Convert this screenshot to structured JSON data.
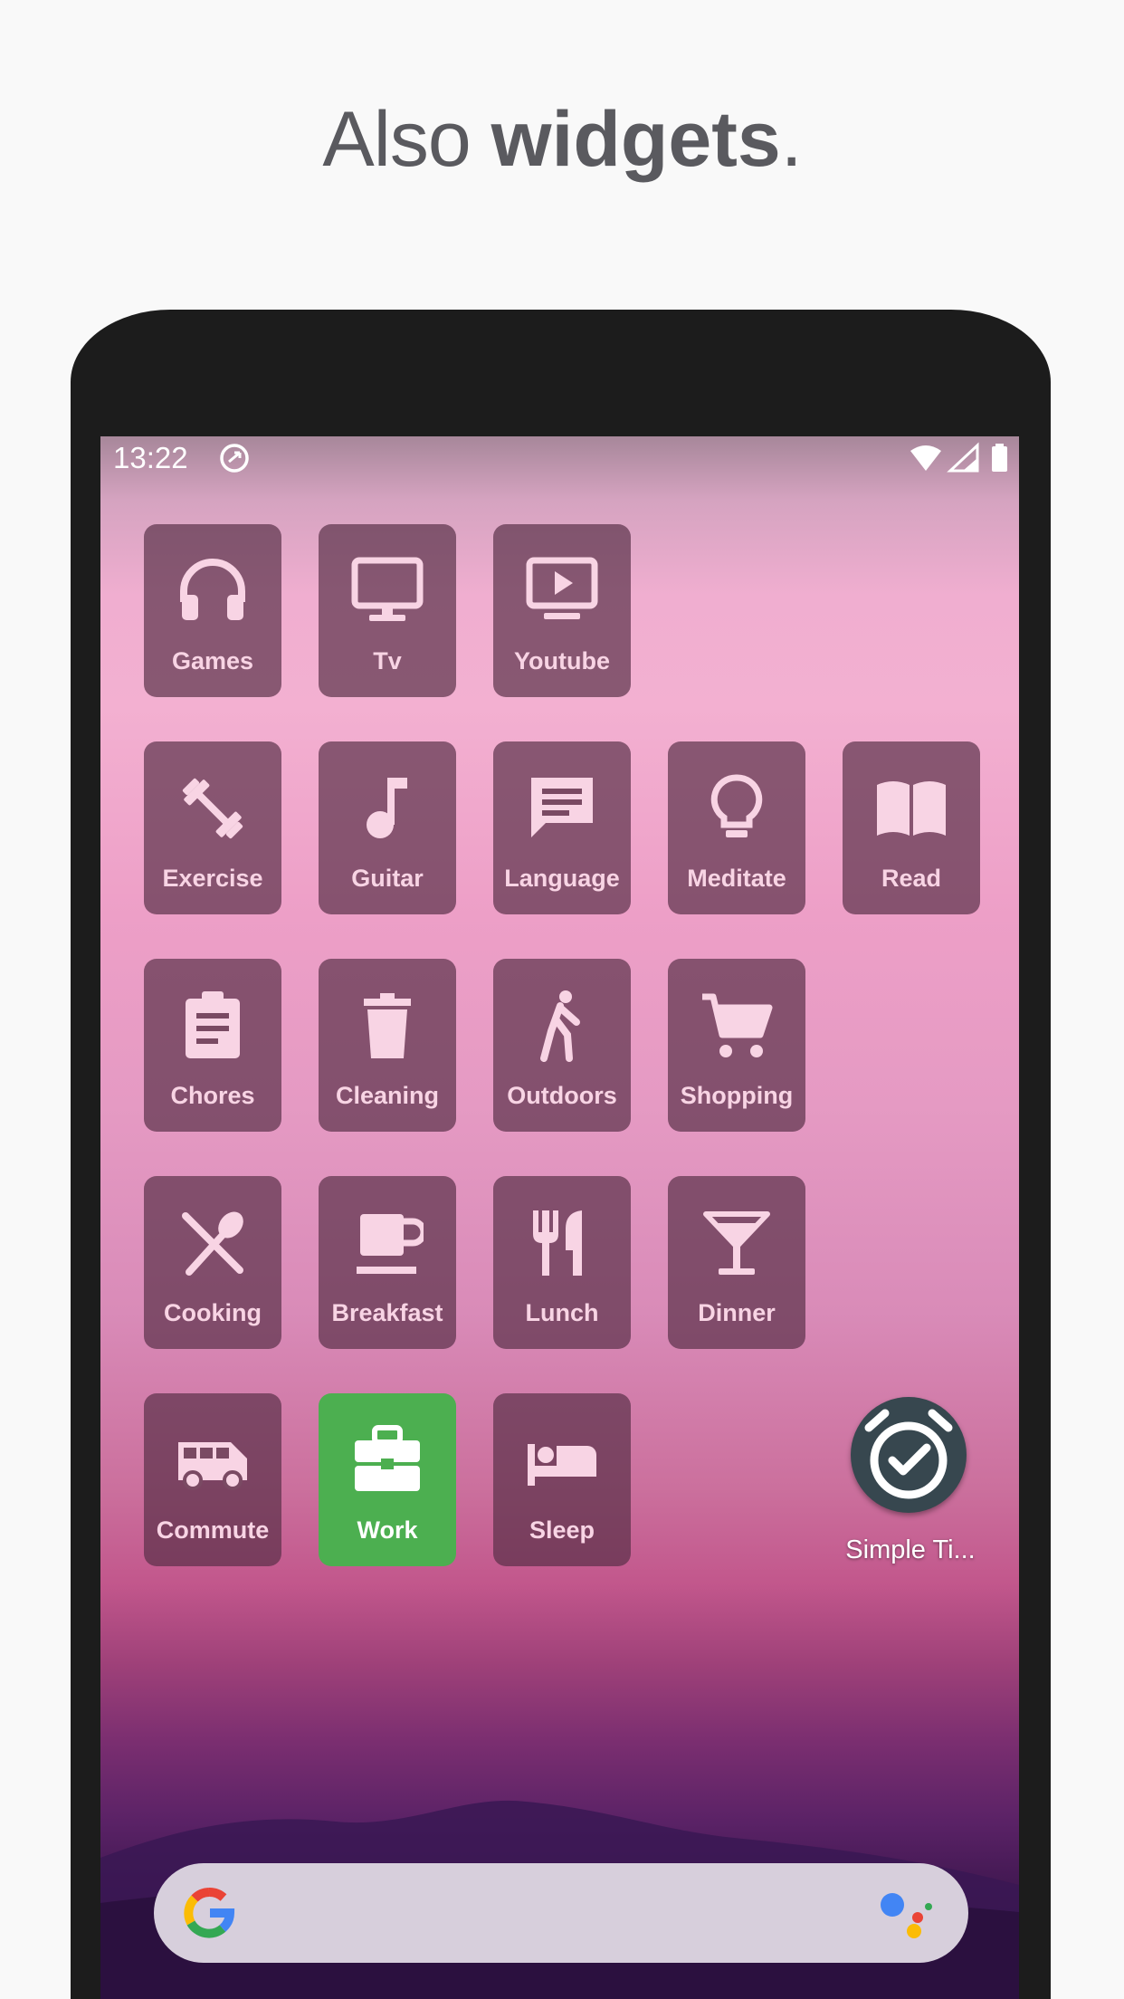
{
  "headline": {
    "light": "Also ",
    "bold": "widgets",
    "period": "."
  },
  "status_bar": {
    "time": "13:22"
  },
  "tiles": [
    {
      "label": "Games",
      "icon": "headphones-icon"
    },
    {
      "label": "Tv",
      "icon": "tv-icon"
    },
    {
      "label": "Youtube",
      "icon": "youtube-icon"
    },
    {
      "label": "Exercise",
      "icon": "dumbbell-icon"
    },
    {
      "label": "Guitar",
      "icon": "music-note-icon"
    },
    {
      "label": "Language",
      "icon": "chat-icon"
    },
    {
      "label": "Meditate",
      "icon": "lightbulb-icon"
    },
    {
      "label": "Read",
      "icon": "book-icon"
    },
    {
      "label": "Chores",
      "icon": "clipboard-icon"
    },
    {
      "label": "Cleaning",
      "icon": "trash-icon"
    },
    {
      "label": "Outdoors",
      "icon": "walking-icon"
    },
    {
      "label": "Shopping",
      "icon": "cart-icon"
    },
    {
      "label": "Cooking",
      "icon": "utensils-cross-icon"
    },
    {
      "label": "Breakfast",
      "icon": "coffee-icon"
    },
    {
      "label": "Lunch",
      "icon": "fork-knife-icon"
    },
    {
      "label": "Dinner",
      "icon": "cocktail-icon"
    },
    {
      "label": "Commute",
      "icon": "bus-icon"
    },
    {
      "label": "Work",
      "icon": "briefcase-icon",
      "active": true
    },
    {
      "label": "Sleep",
      "icon": "bed-icon"
    }
  ],
  "app_shortcut": {
    "label": "Simple Ti...",
    "icon": "alarm-check-icon"
  },
  "colors": {
    "tile_bg": "#552d46",
    "tile_fg": "#f8d4e4",
    "work_green": "#4caf50",
    "app_icon_bg": "#37474f"
  }
}
